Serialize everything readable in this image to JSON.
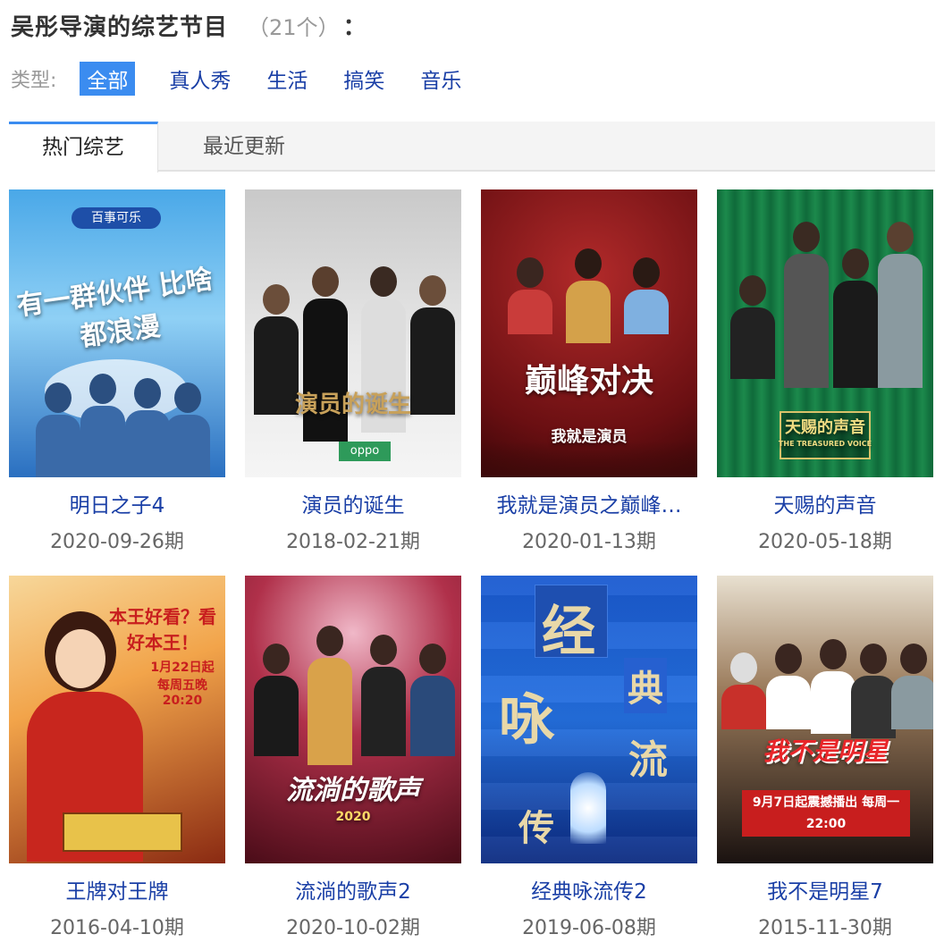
{
  "header": {
    "title": "吴彤导演的综艺节目",
    "count": "（21个）",
    "colon": "："
  },
  "filters": {
    "label": "类型:",
    "options": [
      "全部",
      "真人秀",
      "生活",
      "搞笑",
      "音乐"
    ]
  },
  "tabs": [
    "热门综艺",
    "最近更新"
  ],
  "colors": {
    "accent": "#3b8cf0",
    "link": "#1a3fa6"
  },
  "items": [
    {
      "name": "明日之子4",
      "date": "2020-09-26期",
      "poster_text": "有一群伙伴 比啥都浪漫",
      "logo": "百事可乐"
    },
    {
      "name": "演员的诞生",
      "date": "2018-02-21期",
      "poster_text": "演员的诞生",
      "logo": "oppo"
    },
    {
      "name": "我就是演员之巅峰…",
      "date": "2020-01-13期",
      "poster_text": "巅峰对决",
      "logo": "我就是演员"
    },
    {
      "name": "天赐的声音",
      "date": "2020-05-18期",
      "poster_text": "天赐的声音",
      "logo": "THE TREASURED VOICE"
    },
    {
      "name": "王牌对王牌",
      "date": "2016-04-10期",
      "poster_text": "本王好看？看好本王！",
      "logo": "1月22日起 每周五晚 20:20"
    },
    {
      "name": "流淌的歌声2",
      "date": "2020-10-02期",
      "poster_text": "流淌的歌声",
      "logo": "2020"
    },
    {
      "name": "经典咏流传2",
      "date": "2019-06-08期",
      "poster_text": "经",
      "logo": "典"
    },
    {
      "name": "我不是明星7",
      "date": "2015-11-30期",
      "poster_text": "我不是明星",
      "logo": "9月7日起震撼播出 每周一22:00"
    }
  ]
}
